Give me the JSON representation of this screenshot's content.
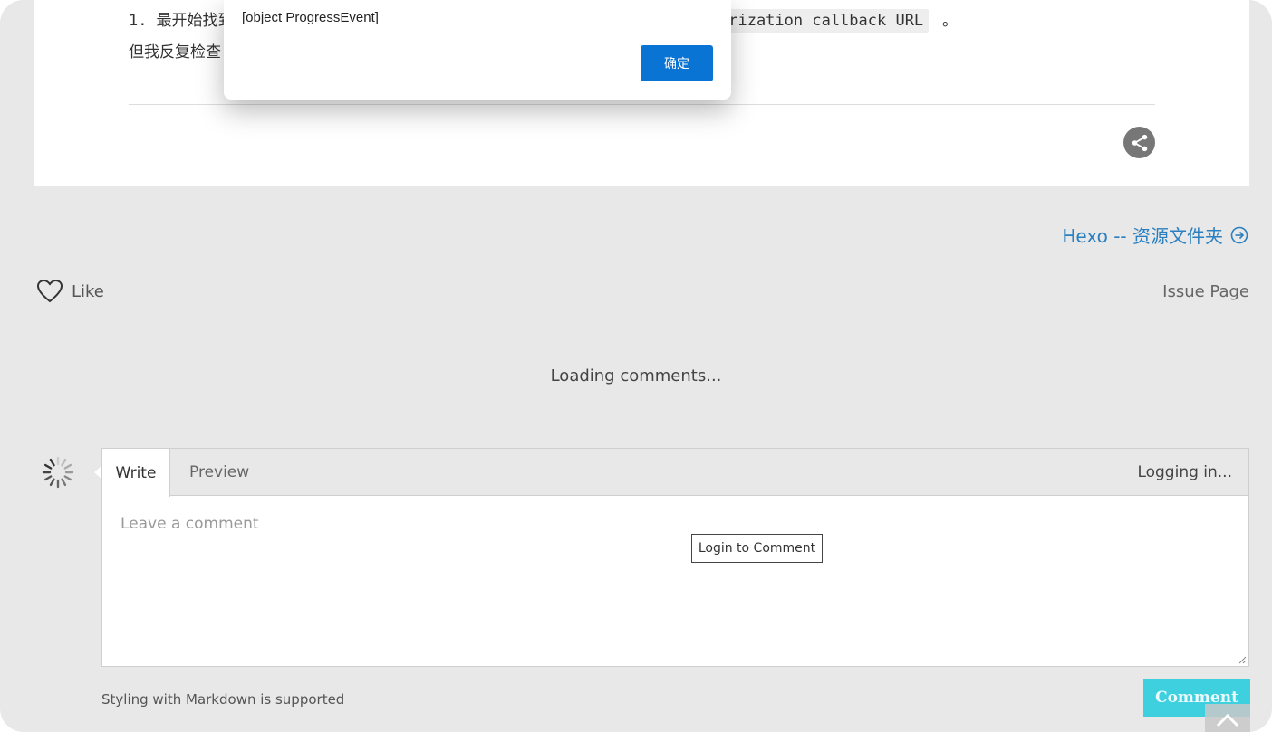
{
  "article": {
    "step_number": "1.",
    "step_text_visible": "最开始找到",
    "code_snippet": "orization callback URL",
    "punctuation": "。",
    "line2_visible": "但我反复检查"
  },
  "navigation": {
    "next_post": "Hexo -- 资源文件夹"
  },
  "actions": {
    "like_label": "Like",
    "issue_page_label": "Issue Page"
  },
  "comments": {
    "loading_text": "Loading comments...",
    "tabs": {
      "write": "Write",
      "preview": "Preview"
    },
    "status": "Logging in...",
    "placeholder": "Leave a comment",
    "login_button": "Login to Comment",
    "markdown_note": "Styling with Markdown is supported",
    "submit_label": "Comment"
  },
  "dialog": {
    "message": "[object ProgressEvent]",
    "ok_label": "确定"
  },
  "colors": {
    "page_bg": "#e8e8e8",
    "link": "#2a7fc0",
    "comment_button": "#3fd0e0",
    "dialog_button": "#0a74d4"
  },
  "icons": {
    "share": "share-icon",
    "next": "circle-arrow-right-icon",
    "like": "heart-outline-icon",
    "loading": "spinner-icon",
    "back_to_top": "chevron-up-icon"
  }
}
